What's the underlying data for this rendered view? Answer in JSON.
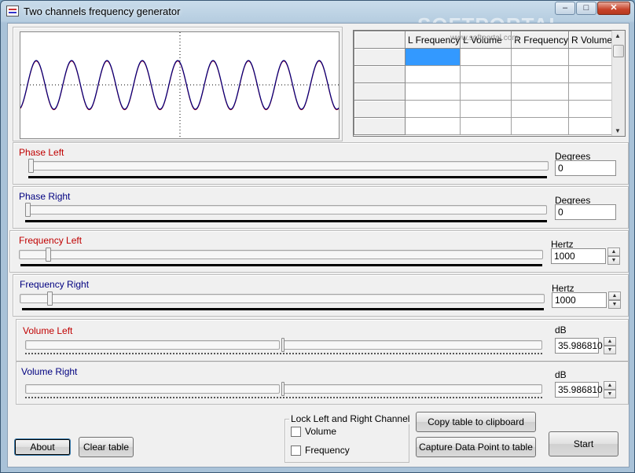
{
  "window": {
    "title": "Two channels frequency generator",
    "watermark": "SOFTPORTAL",
    "watermark_url": "www.softportal.com",
    "buttons": [
      "minimize",
      "maximize",
      "close"
    ]
  },
  "oscilloscope": {
    "left_color": "#c00000",
    "right_color": "#000080",
    "cycles": 9
  },
  "table": {
    "columns": [
      "",
      "L Frequency",
      "L Volume",
      "R Frequency",
      "R Volume"
    ],
    "rows": [
      [
        "",
        "",
        "",
        "",
        ""
      ],
      [
        "",
        "",
        "",
        "",
        ""
      ],
      [
        "",
        "",
        "",
        "",
        ""
      ],
      [
        "",
        "",
        "",
        "",
        ""
      ],
      [
        "",
        "",
        "",
        "",
        ""
      ]
    ],
    "selected_row": 0,
    "selected_col": 1
  },
  "phase_left": {
    "label": "Phase Left",
    "unit": "Degrees",
    "value": "0",
    "position": 0
  },
  "phase_right": {
    "label": "Phase Right",
    "unit": "Degrees",
    "value": "0",
    "position": 0
  },
  "frequency_left": {
    "label": "Frequency Left",
    "unit": "Hertz",
    "value": "1000",
    "position": 0.05
  },
  "frequency_right": {
    "label": "Frequency Right",
    "unit": "Hertz",
    "value": "1000",
    "position": 0.05
  },
  "volume_left": {
    "label": "Volume Left",
    "unit": "dB",
    "value": "35.986810"
  },
  "volume_right": {
    "label": "Volume Right",
    "unit": "dB",
    "value": "35.986810"
  },
  "lock_group": {
    "title": "Lock Left and Right Channel",
    "volume_label": "Volume",
    "frequency_label": "Frequency",
    "volume_checked": false,
    "frequency_checked": false
  },
  "buttons": {
    "about": "About",
    "clear_table": "Clear table",
    "copy_table": "Copy table to clipboard",
    "capture": "Capture Data Point to table",
    "start": "Start"
  },
  "colors": {
    "left_channel": "#c00000",
    "right_channel": "#000080",
    "selection": "#3399ff"
  }
}
